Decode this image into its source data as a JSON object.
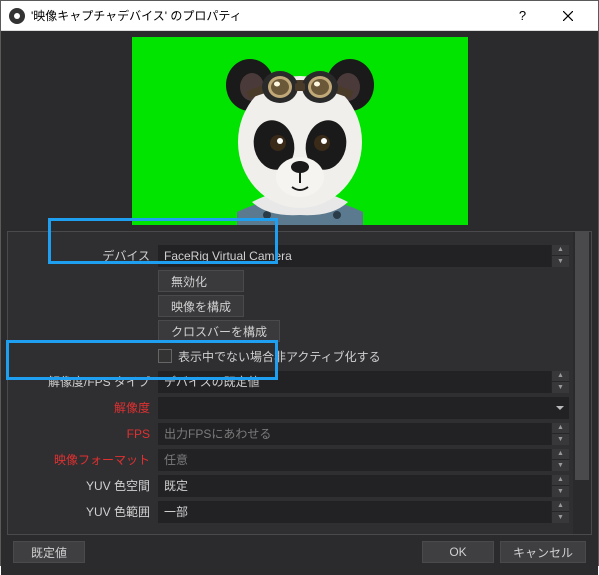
{
  "title": "'映像キャプチャデバイス' のプロパティ",
  "labels": {
    "device": "デバイス",
    "disable": "無効化",
    "configVideo": "映像を構成",
    "configCrossbar": "クロスバーを構成",
    "deactivate": "表示中でない場合非アクティブ化する",
    "resFpsType": "解像度/FPS タイプ",
    "resolution": "解像度",
    "fps": "FPS",
    "videoFormat": "映像フォーマット",
    "yuvSpace": "YUV 色空間",
    "yuvRange": "YUV 色範囲"
  },
  "values": {
    "device": "FaceRig Virtual Camera",
    "resFpsType": "デバイスの既定値",
    "resolution": "",
    "fps": "出力FPSにあわせる",
    "videoFormat": "任意",
    "yuvSpace": "既定",
    "yuvRange": "一部"
  },
  "footer": {
    "defaults": "既定値",
    "ok": "OK",
    "cancel": "キャンセル"
  }
}
